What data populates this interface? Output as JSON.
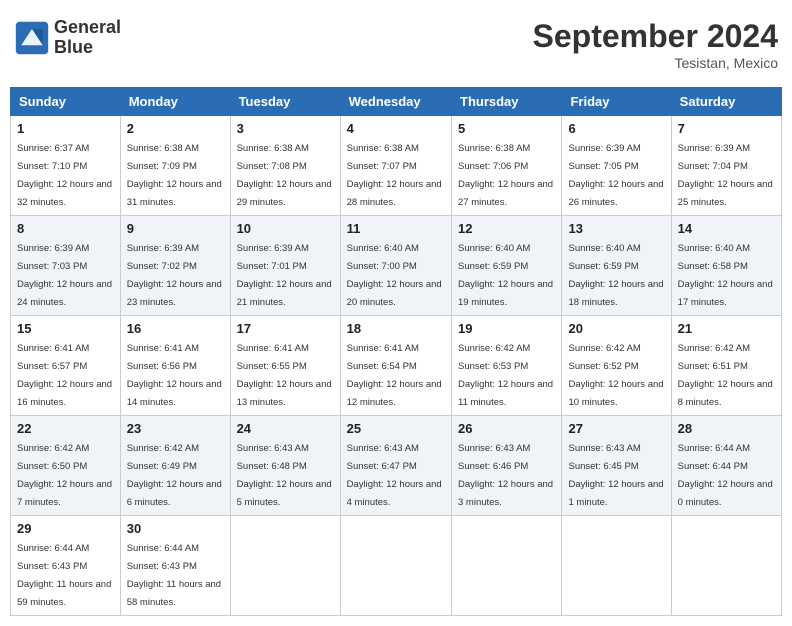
{
  "logo": {
    "line1": "General",
    "line2": "Blue"
  },
  "title": "September 2024",
  "location": "Tesistan, Mexico",
  "weekdays": [
    "Sunday",
    "Monday",
    "Tuesday",
    "Wednesday",
    "Thursday",
    "Friday",
    "Saturday"
  ],
  "weeks": [
    [
      {
        "day": "1",
        "sunrise": "6:37 AM",
        "sunset": "7:10 PM",
        "daylight": "12 hours and 32 minutes."
      },
      {
        "day": "2",
        "sunrise": "6:38 AM",
        "sunset": "7:09 PM",
        "daylight": "12 hours and 31 minutes."
      },
      {
        "day": "3",
        "sunrise": "6:38 AM",
        "sunset": "7:08 PM",
        "daylight": "12 hours and 29 minutes."
      },
      {
        "day": "4",
        "sunrise": "6:38 AM",
        "sunset": "7:07 PM",
        "daylight": "12 hours and 28 minutes."
      },
      {
        "day": "5",
        "sunrise": "6:38 AM",
        "sunset": "7:06 PM",
        "daylight": "12 hours and 27 minutes."
      },
      {
        "day": "6",
        "sunrise": "6:39 AM",
        "sunset": "7:05 PM",
        "daylight": "12 hours and 26 minutes."
      },
      {
        "day": "7",
        "sunrise": "6:39 AM",
        "sunset": "7:04 PM",
        "daylight": "12 hours and 25 minutes."
      }
    ],
    [
      {
        "day": "8",
        "sunrise": "6:39 AM",
        "sunset": "7:03 PM",
        "daylight": "12 hours and 24 minutes."
      },
      {
        "day": "9",
        "sunrise": "6:39 AM",
        "sunset": "7:02 PM",
        "daylight": "12 hours and 23 minutes."
      },
      {
        "day": "10",
        "sunrise": "6:39 AM",
        "sunset": "7:01 PM",
        "daylight": "12 hours and 21 minutes."
      },
      {
        "day": "11",
        "sunrise": "6:40 AM",
        "sunset": "7:00 PM",
        "daylight": "12 hours and 20 minutes."
      },
      {
        "day": "12",
        "sunrise": "6:40 AM",
        "sunset": "6:59 PM",
        "daylight": "12 hours and 19 minutes."
      },
      {
        "day": "13",
        "sunrise": "6:40 AM",
        "sunset": "6:59 PM",
        "daylight": "12 hours and 18 minutes."
      },
      {
        "day": "14",
        "sunrise": "6:40 AM",
        "sunset": "6:58 PM",
        "daylight": "12 hours and 17 minutes."
      }
    ],
    [
      {
        "day": "15",
        "sunrise": "6:41 AM",
        "sunset": "6:57 PM",
        "daylight": "12 hours and 16 minutes."
      },
      {
        "day": "16",
        "sunrise": "6:41 AM",
        "sunset": "6:56 PM",
        "daylight": "12 hours and 14 minutes."
      },
      {
        "day": "17",
        "sunrise": "6:41 AM",
        "sunset": "6:55 PM",
        "daylight": "12 hours and 13 minutes."
      },
      {
        "day": "18",
        "sunrise": "6:41 AM",
        "sunset": "6:54 PM",
        "daylight": "12 hours and 12 minutes."
      },
      {
        "day": "19",
        "sunrise": "6:42 AM",
        "sunset": "6:53 PM",
        "daylight": "12 hours and 11 minutes."
      },
      {
        "day": "20",
        "sunrise": "6:42 AM",
        "sunset": "6:52 PM",
        "daylight": "12 hours and 10 minutes."
      },
      {
        "day": "21",
        "sunrise": "6:42 AM",
        "sunset": "6:51 PM",
        "daylight": "12 hours and 8 minutes."
      }
    ],
    [
      {
        "day": "22",
        "sunrise": "6:42 AM",
        "sunset": "6:50 PM",
        "daylight": "12 hours and 7 minutes."
      },
      {
        "day": "23",
        "sunrise": "6:42 AM",
        "sunset": "6:49 PM",
        "daylight": "12 hours and 6 minutes."
      },
      {
        "day": "24",
        "sunrise": "6:43 AM",
        "sunset": "6:48 PM",
        "daylight": "12 hours and 5 minutes."
      },
      {
        "day": "25",
        "sunrise": "6:43 AM",
        "sunset": "6:47 PM",
        "daylight": "12 hours and 4 minutes."
      },
      {
        "day": "26",
        "sunrise": "6:43 AM",
        "sunset": "6:46 PM",
        "daylight": "12 hours and 3 minutes."
      },
      {
        "day": "27",
        "sunrise": "6:43 AM",
        "sunset": "6:45 PM",
        "daylight": "12 hours and 1 minute."
      },
      {
        "day": "28",
        "sunrise": "6:44 AM",
        "sunset": "6:44 PM",
        "daylight": "12 hours and 0 minutes."
      }
    ],
    [
      {
        "day": "29",
        "sunrise": "6:44 AM",
        "sunset": "6:43 PM",
        "daylight": "11 hours and 59 minutes."
      },
      {
        "day": "30",
        "sunrise": "6:44 AM",
        "sunset": "6:43 PM",
        "daylight": "11 hours and 58 minutes."
      },
      null,
      null,
      null,
      null,
      null
    ]
  ]
}
